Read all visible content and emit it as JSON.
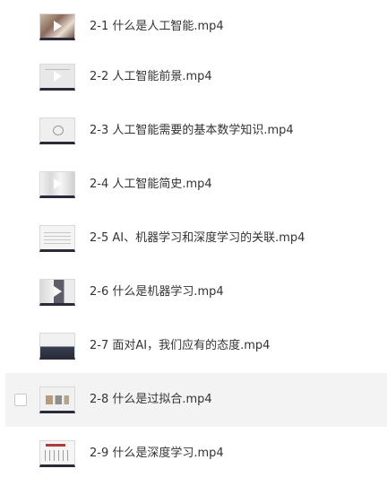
{
  "files": [
    {
      "name": "2-1 什么是人工智能.mp4",
      "thumb_icon": "video-thumbnail-icon",
      "play_icon": true
    },
    {
      "name": "2-2 人工智能前景.mp4",
      "thumb_icon": "video-thumbnail-icon",
      "play_icon": true
    },
    {
      "name": "2-3 人工智能需要的基本数学知识.mp4",
      "thumb_icon": "video-thumbnail-icon",
      "play_icon": false
    },
    {
      "name": "2-4 人工智能简史.mp4",
      "thumb_icon": "video-thumbnail-icon",
      "play_icon": true
    },
    {
      "name": "2-5 AI、机器学习和深度学习的关联.mp4",
      "thumb_icon": "video-thumbnail-icon",
      "play_icon": false
    },
    {
      "name": "2-6 什么是机器学习.mp4",
      "thumb_icon": "video-thumbnail-icon",
      "play_icon": true
    },
    {
      "name": "2-7 面对AI，我们应有的态度.mp4",
      "thumb_icon": "video-thumbnail-icon",
      "play_icon": false
    },
    {
      "name": "2-8 什么是过拟合.mp4",
      "thumb_icon": "video-thumbnail-icon",
      "play_icon": false,
      "hovered": true,
      "checked": false
    },
    {
      "name": "2-9 什么是深度学习.mp4",
      "thumb_icon": "video-thumbnail-icon",
      "play_icon": false
    }
  ],
  "colors": {
    "text": "#333333",
    "hover_row": "#f3f3f3",
    "thumb_bar": "#2a2a3a"
  }
}
